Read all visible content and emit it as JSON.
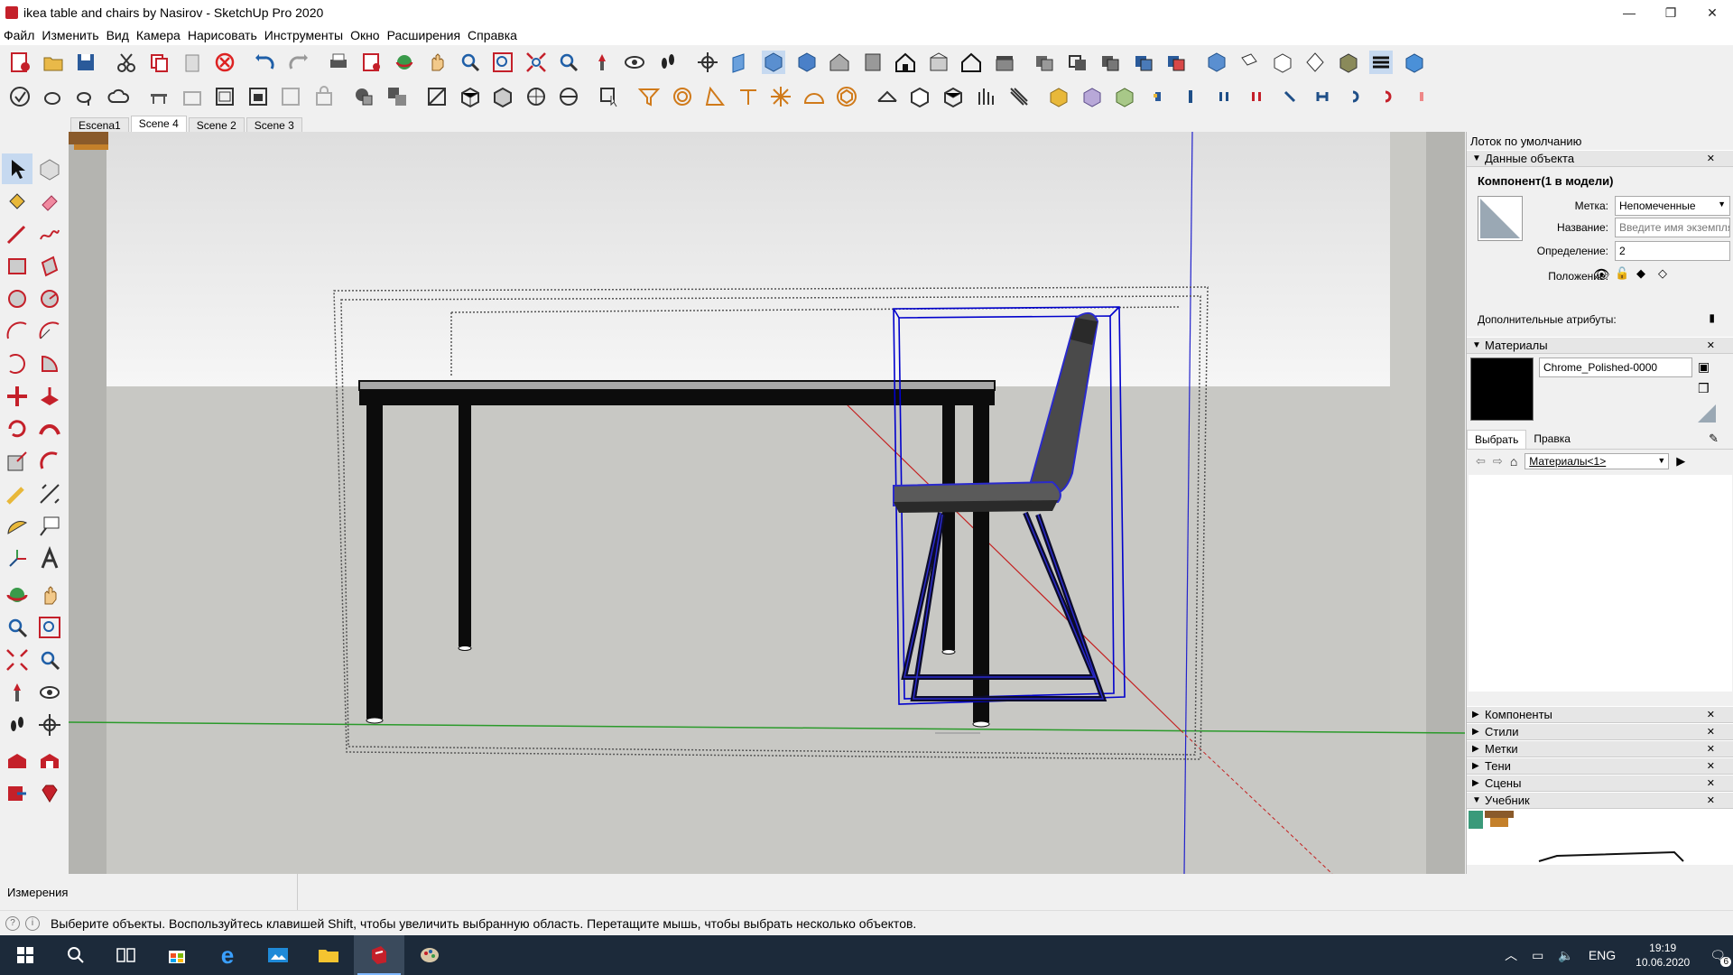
{
  "window": {
    "title": "ikea table and chairs by Nasirov - SketchUp Pro 2020",
    "minimize": "—",
    "maximize": "❐",
    "close": "✕"
  },
  "menu": [
    "Файл",
    "Изменить",
    "Вид",
    "Камера",
    "Нарисовать",
    "Инструменты",
    "Окно",
    "Расширения",
    "Справка"
  ],
  "scenes": {
    "tabs": [
      "Escena1",
      "Scene 4",
      "Scene 2",
      "Scene 3"
    ],
    "active": "Scene 4"
  },
  "tray": {
    "title": "Лоток по умолчанию",
    "entity_info": {
      "header": "Данные объекта",
      "component_title": "Компонент(1 в модели)",
      "tag_label": "Метка:",
      "tag_value": "Непомеченные",
      "name_label": "Название:",
      "name_placeholder": "Введите имя экземпля",
      "definition_label": "Определение:",
      "definition_value": "2",
      "position_label": "Положение:",
      "advanced_label": "Дополнительные атрибуты:"
    },
    "materials": {
      "header": "Материалы",
      "material_name": "Chrome_Polished-0000",
      "material_color": "#000000",
      "tab_select": "Выбрать",
      "tab_edit": "Правка",
      "collection": "Материалы<1>"
    },
    "collapsed_panels": [
      "Компоненты",
      "Стили",
      "Метки",
      "Тени",
      "Сцены"
    ],
    "tutorial_header": "Учебник"
  },
  "measurements": {
    "label": "Измерения"
  },
  "status": {
    "text": "Выберите объекты. Воспользуйтесь клавишей Shift, чтобы увеличить выбранную область. Перетащите мышь, чтобы выбрать несколько объектов."
  },
  "taskbar": {
    "language": "ENG",
    "time": "19:19",
    "date": "10.06.2020",
    "notifications": "6"
  },
  "colors": {
    "sky": "#f2f2f2",
    "ground": "#c8c8c4",
    "selection": "#0000cc",
    "accent_red": "#c4202a"
  }
}
